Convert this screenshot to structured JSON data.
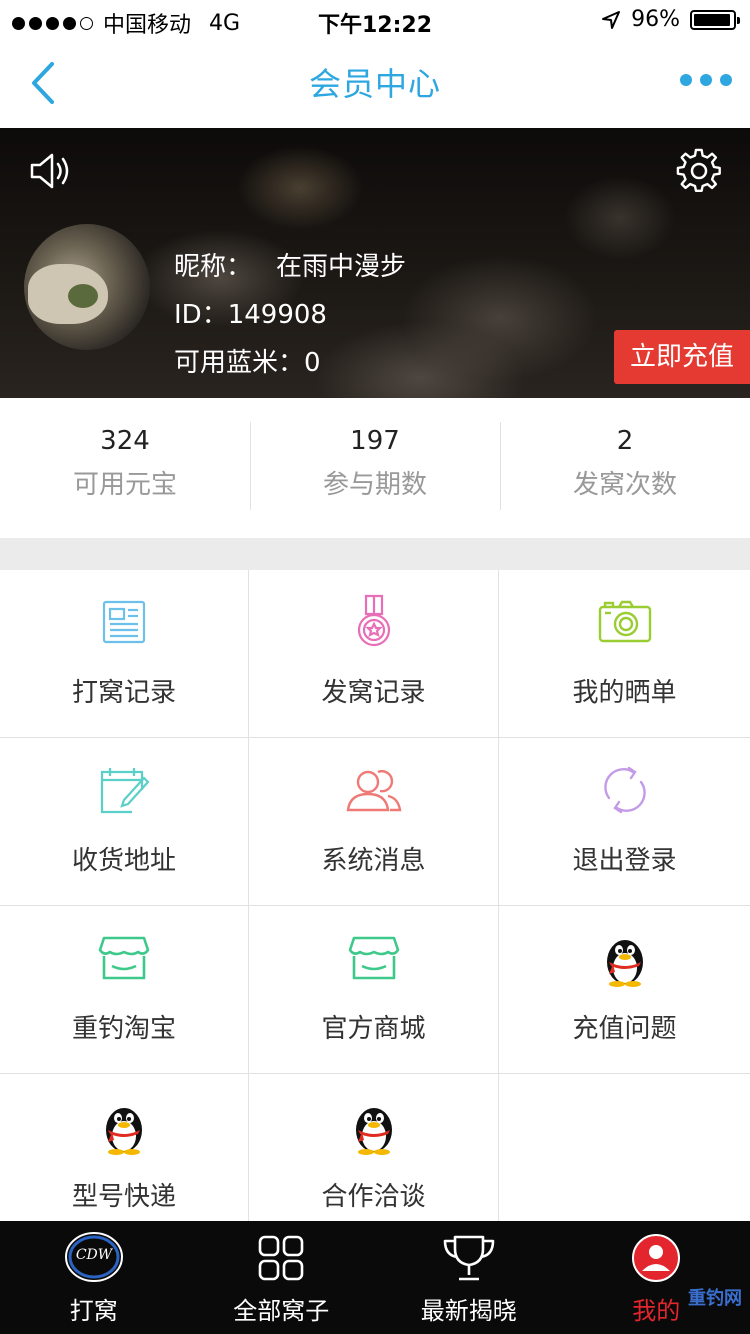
{
  "status_bar": {
    "carrier": "中国移动",
    "network": "4G",
    "time": "下午12:22",
    "battery": "96%",
    "battery_level": 0.96
  },
  "nav": {
    "title": "会员中心",
    "accent_color": "#2ea7e0"
  },
  "profile": {
    "nickname_label": "昵称：",
    "nickname": "在雨中漫步",
    "id_text": "ID：149908",
    "balance_text": "可用蓝米：0",
    "recharge_label": "立即充值",
    "recharge_color": "#e53a32"
  },
  "stats": [
    {
      "value": "324",
      "label": "可用元宝"
    },
    {
      "value": "197",
      "label": "参与期数"
    },
    {
      "value": "2",
      "label": "发窝次数"
    }
  ],
  "menu": [
    {
      "label": "打窝记录",
      "icon": "news-icon"
    },
    {
      "label": "发窝记录",
      "icon": "medal-icon"
    },
    {
      "label": "我的晒单",
      "icon": "camera-icon"
    },
    {
      "label": "收货地址",
      "icon": "calendar-edit-icon"
    },
    {
      "label": "系统消息",
      "icon": "users-icon"
    },
    {
      "label": "退出登录",
      "icon": "refresh-icon"
    },
    {
      "label": "重钓淘宝",
      "icon": "shop-icon"
    },
    {
      "label": "官方商城",
      "icon": "shop-icon"
    },
    {
      "label": "充值问题",
      "icon": "qq-penguin-icon"
    },
    {
      "label": "型号快递",
      "icon": "qq-penguin-icon"
    },
    {
      "label": "合作洽谈",
      "icon": "qq-penguin-icon"
    }
  ],
  "tabs": [
    {
      "label": "打窝",
      "icon": "fishing-logo-icon"
    },
    {
      "label": "全部窝子",
      "icon": "grid-icon"
    },
    {
      "label": "最新揭晓",
      "icon": "trophy-icon"
    },
    {
      "label": "我的",
      "icon": "user-icon",
      "active": true
    }
  ],
  "watermark": "重钓网"
}
